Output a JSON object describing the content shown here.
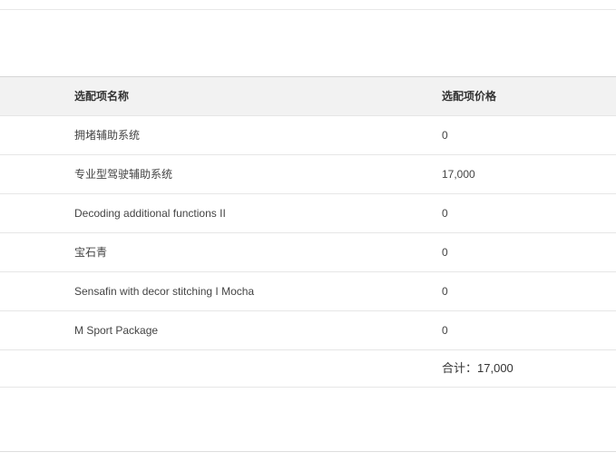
{
  "table": {
    "header": {
      "name": "选配项名称",
      "price": "选配项价格"
    },
    "rows": [
      {
        "name": "拥堵辅助系统",
        "price": "0"
      },
      {
        "name": "专业型驾驶辅助系统",
        "price": "17,000"
      },
      {
        "name": "Decoding additional functions II",
        "price": "0"
      },
      {
        "name": "宝石青",
        "price": "0"
      },
      {
        "name": "Sensafin with decor stitching I Mocha",
        "price": "0"
      },
      {
        "name": "M Sport Package",
        "price": "0"
      }
    ],
    "total": {
      "label": "合计：",
      "value": "17,000"
    }
  }
}
